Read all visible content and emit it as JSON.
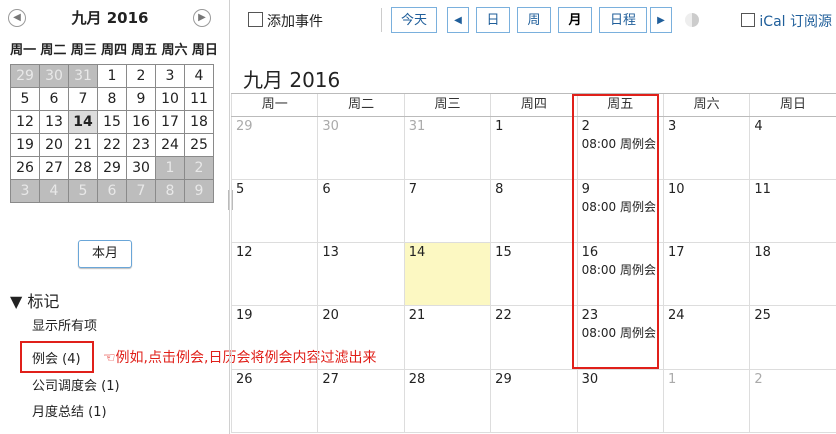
{
  "mini": {
    "title": "九月 2016",
    "prev": "◀",
    "next": "▶",
    "weekdays": [
      "周一",
      "周二",
      "周三",
      "周四",
      "周五",
      "周六",
      "周日"
    ],
    "days": [
      [
        "29",
        "30",
        "31",
        "1",
        "2",
        "3",
        "4"
      ],
      [
        "5",
        "6",
        "7",
        "8",
        "9",
        "10",
        "11"
      ],
      [
        "12",
        "13",
        "14",
        "15",
        "16",
        "17",
        "18"
      ],
      [
        "19",
        "20",
        "21",
        "22",
        "23",
        "24",
        "25"
      ],
      [
        "26",
        "27",
        "28",
        "29",
        "30",
        "1",
        "2"
      ],
      [
        "3",
        "4",
        "5",
        "6",
        "7",
        "8",
        "9"
      ]
    ],
    "this_month": "本月"
  },
  "tags": {
    "title": "▼ 标记",
    "show_all": "显示所有项",
    "items": [
      "例会 (4)",
      "公司调度会 (1)",
      "月度总结 (1)"
    ],
    "annotation": "☜例如,点击例会,日历会将例会内容过滤出来"
  },
  "toolbar": {
    "add": "添加事件",
    "today": "今天",
    "prev": "◀",
    "day": "日",
    "week": "周",
    "month": "月",
    "agenda": "日程",
    "next": "▶",
    "ical": "iCal 订阅源"
  },
  "main": {
    "title": "九月 2016",
    "weekdays": [
      "周一",
      "周二",
      "周三",
      "周四",
      "周五",
      "周六",
      "周日"
    ],
    "weeks": [
      [
        "29",
        "30",
        "31",
        "1",
        "2",
        "3",
        "4"
      ],
      [
        "5",
        "6",
        "7",
        "8",
        "9",
        "10",
        "11"
      ],
      [
        "12",
        "13",
        "14",
        "15",
        "16",
        "17",
        "18"
      ],
      [
        "19",
        "20",
        "21",
        "22",
        "23",
        "24",
        "25"
      ],
      [
        "26",
        "27",
        "28",
        "29",
        "30",
        "1",
        "2"
      ]
    ],
    "events": {
      "0-4": "08:00 周例会",
      "1-4": "08:00 周例会",
      "2-4": "08:00 周例会",
      "3-4": "08:00 周例会"
    }
  },
  "colors": {
    "accent": "#1f5e9a",
    "highlight_red": "#e0201a",
    "today_bg": "#fcf8c2"
  }
}
